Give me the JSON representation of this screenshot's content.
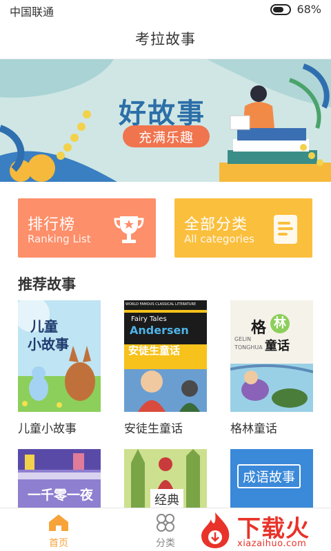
{
  "status": {
    "carrier": "中国联通",
    "battery_text": "68%",
    "battery_level": 0.68
  },
  "header": {
    "title": "考拉故事"
  },
  "banner": {
    "headline": "好故事",
    "pill": "充满乐趣"
  },
  "categories": [
    {
      "cn": "排行榜",
      "en": "Ranking List",
      "color": "#fd8f6a",
      "icon": "trophy-icon"
    },
    {
      "cn": "全部分类",
      "en": "All categories",
      "color": "#fbbf3e",
      "icon": "document-icon"
    }
  ],
  "recommend": {
    "title": "推荐故事",
    "books": [
      {
        "name": "儿童小故事",
        "cover_text": [
          "儿童",
          "小故事"
        ]
      },
      {
        "name": "安徒生童话",
        "cover_text": [
          "Fairy Tales",
          "Andersen",
          "安徒生童话",
          "WORLD FAMOUS CLASSICAL LITERATURE"
        ]
      },
      {
        "name": "格林童话",
        "cover_text": [
          "格",
          "林",
          "童话",
          "GELIN",
          "TONGHUA"
        ]
      }
    ],
    "books_row2": [
      {
        "cover_text": [
          "一千零一夜"
        ]
      },
      {
        "cover_text": [
          "经典"
        ]
      },
      {
        "cover_text": [
          "成语故事"
        ]
      }
    ]
  },
  "tabbar": {
    "home": "首页",
    "category": "分类"
  },
  "watermark": {
    "cn": "下载火",
    "en": "xiazaihuo.com"
  },
  "colors": {
    "accent": "#f7a339",
    "banner_bg": "#cfe6e4",
    "headline": "#2c6fa8",
    "pill": "#f0744e",
    "watermark": "#e8332a"
  }
}
